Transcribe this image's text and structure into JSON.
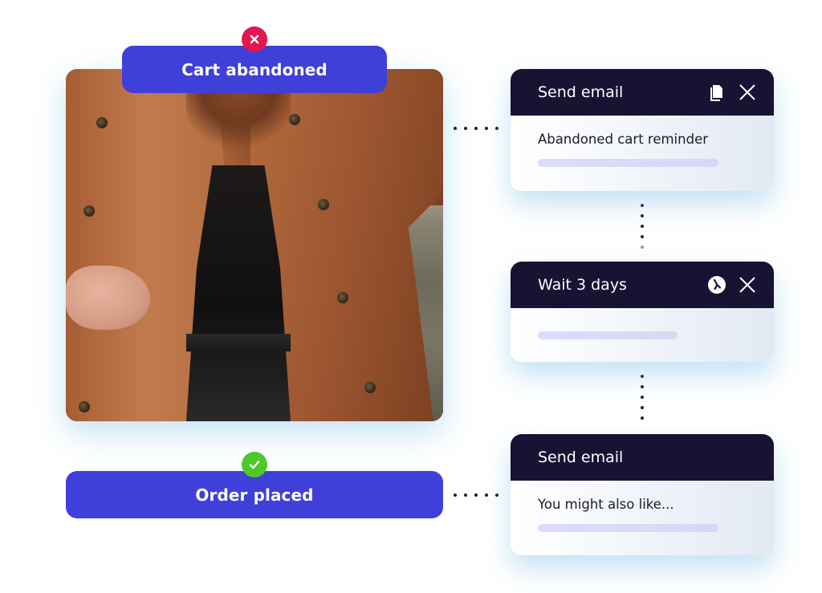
{
  "events": {
    "start": {
      "label": "Cart abandoned",
      "status_icon": "x-circle-icon",
      "status_color": "#e2174f"
    },
    "end": {
      "label": "Order placed",
      "status_icon": "check-circle-icon",
      "status_color": "#4ec82a"
    },
    "pill_color": "#3f3fd9"
  },
  "image": {
    "alt": "Woman wearing a brown trench coat"
  },
  "steps": [
    {
      "title": "Send email",
      "body_text": "Abandoned cart reminder",
      "icons": [
        "copy-icon",
        "close-icon"
      ]
    },
    {
      "title": "Wait 3 days",
      "body_text": "",
      "icons": [
        "clock-icon",
        "close-icon"
      ]
    },
    {
      "title": "Send email",
      "body_text": "You might also like...",
      "icons": []
    }
  ],
  "colors": {
    "card_header": "#181233",
    "placeholder_bar": "#dcdcfa"
  }
}
